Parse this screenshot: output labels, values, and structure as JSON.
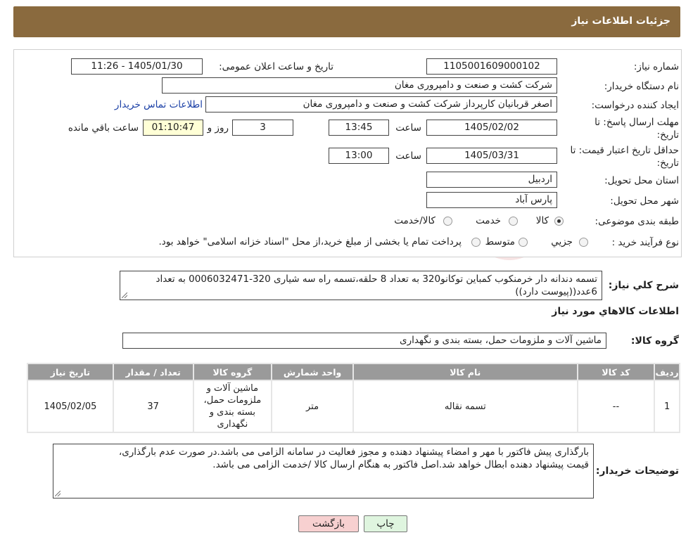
{
  "page_title": "جزئیات اطلاعات نیاز",
  "fields": {
    "need_number_label": "شماره نیاز:",
    "need_number": "1105001609000102",
    "announce_label": "تاریخ و ساعت اعلان عمومی:",
    "announce_value": "1405/01/30 - 11:26",
    "buyer_org_label": "نام دستگاه خریدار:",
    "buyer_org": "شرکت کشت و صنعت و دامپروری مغان",
    "creator_label": "ایجاد کننده درخواست:",
    "creator": "اصغر قربانیان کارپرداز شرکت کشت و صنعت و دامپروری مغان",
    "contact_link": "اطلاعات تماس خریدار",
    "deadline_label_1": "مهلت ارسال پاسخ: تا",
    "deadline_label_2": "تاریخ:",
    "deadline_date": "1405/02/02",
    "time_label": "ساعت",
    "deadline_time": "13:45",
    "days_value": "3",
    "days_label": "روز و",
    "remaining_time": "01:10:47",
    "remaining_label": "ساعت باقي مانده",
    "validity_label_1": "حداقل تاریخ اعتبار قیمت: تا",
    "validity_label_2": "تاریخ:",
    "validity_date": "1405/03/31",
    "validity_time": "13:00",
    "province_label": "استان محل تحویل:",
    "province": "اردبیل",
    "city_label": "شهر محل تحویل:",
    "city": "پارس آباد",
    "category_label": "طبقه بندی موضوعی:",
    "category_options": [
      "کالا",
      "خدمت",
      "کالا/خدمت"
    ],
    "purchase_label": "نوع فرآیند خرید :",
    "purchase_options": [
      "جزيي",
      "متوسط"
    ],
    "purchase_note": "پرداخت تمام یا بخشی از مبلغ خرید،از محل \"اسناد خزانه اسلامی\" خواهد بود."
  },
  "summary": {
    "label": "شرح کلي نیاز:",
    "line1": "تسمه دندانه دار خرمنکوب کمباین توکانو320 به تعداد 8 حلقه،تسمه راه سه شیاری 320-0006032471 به تعداد",
    "line2": "6عدد((پیوست دارد))"
  },
  "goods_info_title": "اطلاعات کالاهاي مورد نیاز",
  "goods_group_label": "گروه کالا:",
  "goods_group": "ماشین آلات و ملزومات حمل، بسته بندی و نگهداری",
  "table": {
    "headers": [
      "ردیف",
      "کد کالا",
      "نام کالا",
      "واحد شمارش",
      "گروه کالا",
      "تعداد / مقدار",
      "تاریخ نیاز"
    ],
    "rows": [
      {
        "row": "1",
        "code": "--",
        "name": "تسمه نقاله",
        "unit": "متر",
        "group_lines": [
          "ماشین آلات و",
          "ملزومات حمل،",
          "بسته بندی و",
          "نگهداری"
        ],
        "qty": "37",
        "date": "1405/02/05"
      }
    ]
  },
  "buyer_notes": {
    "label": "توضیحات خریدار:",
    "line1": "بارگذاری پیش فاکتور با مهر و امضاء پیشنهاد دهنده و مجوز فعالیت در سامانه الزامی می باشد.در صورت عدم بارگذاری،",
    "line2": "قیمت پیشنهاد دهنده ابطال خواهد شد.اصل فاکتور به هنگام ارسال کالا /خدمت الزامی می باشد."
  },
  "buttons": {
    "print": "چاپ",
    "back": "بازگشت"
  },
  "colors": {
    "header_bg": "#8a6a3e",
    "back_button_bg": "#f7d0d0",
    "print_button_bg": "#dff5df",
    "remaining_bg": "#ffffd6"
  }
}
